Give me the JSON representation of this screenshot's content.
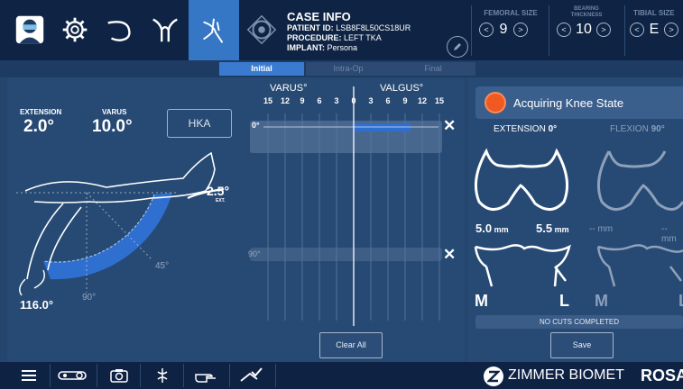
{
  "case_info": {
    "title": "CASE INFO",
    "patient_id_label": "PATIENT ID:",
    "patient_id": "LSB8F8L50CS18UR",
    "procedure_label": "PROCEDURE:",
    "procedure": "LEFT TKA",
    "implant_label": "IMPLANT:",
    "implant": "Persona"
  },
  "sizers": {
    "femoral": {
      "label": "FEMORAL SIZE",
      "value": "9"
    },
    "bearing": {
      "label_line1": "BEARING",
      "label_line2": "THICKNESS",
      "value": "10"
    },
    "tibial": {
      "label": "TIBIAL SIZE",
      "value": "E"
    }
  },
  "tabs": [
    "Initial",
    "Intra-Op",
    "Final"
  ],
  "left_panel": {
    "extension_label": "EXTENSION",
    "extension_value": "2.0°",
    "varus_label": "VARUS",
    "varus_value": "10.0°",
    "hka_label": "HKA",
    "ext_angle": "2.5°",
    "ext_angle_sub": "EXT.",
    "flex_max": "116.0°",
    "arc_45": "45°",
    "arc_90": "90°"
  },
  "varus_valgus": {
    "varus_label": "VARUS°",
    "valgus_label": "VALGUS°",
    "ticks": [
      "15",
      "12",
      "9",
      "6",
      "3",
      "0",
      "3",
      "6",
      "9",
      "12",
      "15"
    ],
    "row_extension_label": "0°",
    "row_flexion_label": "90°",
    "extension_value": 10,
    "clear_all": "Clear All"
  },
  "right_panel": {
    "status": "Acquiring Knee State",
    "extension_label": "EXTENSION",
    "extension_deg": "0°",
    "flexion_label": "FLEXION",
    "flexion_deg": "90°",
    "gap_medial": "5.0",
    "gap_lateral": "5.5",
    "gap_unit": "mm",
    "gap_flex_medial": "--",
    "gap_flex_lateral": "--",
    "m_label": "M",
    "l_label": "L",
    "m_label_flex": "M",
    "l_label_flex": "L",
    "no_cuts": "NO CUTS COMPLETED",
    "save": "Save"
  },
  "brand": {
    "company": "ZIMMER BIOMET",
    "product": "ROSA"
  },
  "colors": {
    "accent": "#3a7bd0",
    "status_orange": "#f05a22",
    "background": "#24456e"
  }
}
